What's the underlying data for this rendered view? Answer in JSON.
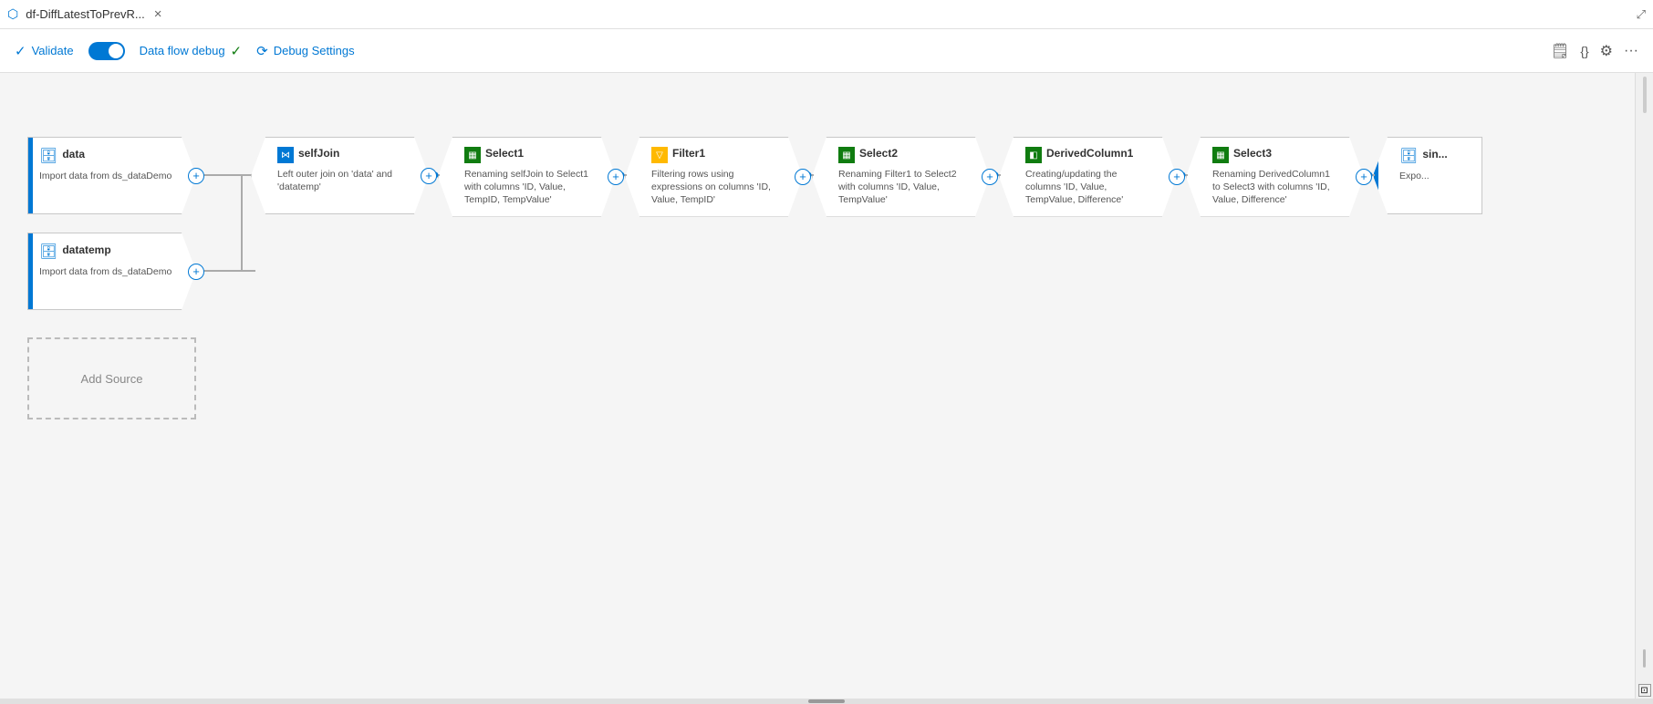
{
  "titleBar": {
    "title": "df-DiffLatestToPrevR...",
    "closeLabel": "×",
    "expandLabel": "⤢"
  },
  "toolbar": {
    "validateLabel": "Validate",
    "dataFlowDebugLabel": "Data flow debug",
    "debugSettingsLabel": "Debug Settings",
    "scriptIcon": "{}",
    "settingsIcon": "⚙"
  },
  "nodes": {
    "data": {
      "title": "data",
      "subtitle": "Import data from ds_dataDemo",
      "type": "source"
    },
    "datatemp": {
      "title": "datatemp",
      "subtitle": "Import data from ds_dataDemo",
      "type": "source"
    },
    "addSource": {
      "label": "Add Source"
    },
    "selfJoin": {
      "title": "selfJoin",
      "subtitle": "Left outer join on 'data' and 'datatemp'",
      "type": "join"
    },
    "select1": {
      "title": "Select1",
      "subtitle": "Renaming selfJoin to Select1 with columns 'ID, Value, TempID, TempValue'",
      "type": "select"
    },
    "filter1": {
      "title": "Filter1",
      "subtitle": "Filtering rows using expressions on columns 'ID, Value, TempID'",
      "type": "filter"
    },
    "select2": {
      "title": "Select2",
      "subtitle": "Renaming Filter1 to Select2 with columns 'ID, Value, TempValue'",
      "type": "select"
    },
    "derivedColumn1": {
      "title": "DerivedColumn1",
      "subtitle": "Creating/updating the columns 'ID, Value, TempValue, Difference'",
      "type": "derived"
    },
    "select3": {
      "title": "Select3",
      "subtitle": "Renaming DerivedColumn1 to Select3 with columns 'ID, Value, Difference'",
      "type": "select"
    },
    "sink": {
      "title": "sin...",
      "subtitle": "Expo...",
      "type": "sink"
    }
  }
}
